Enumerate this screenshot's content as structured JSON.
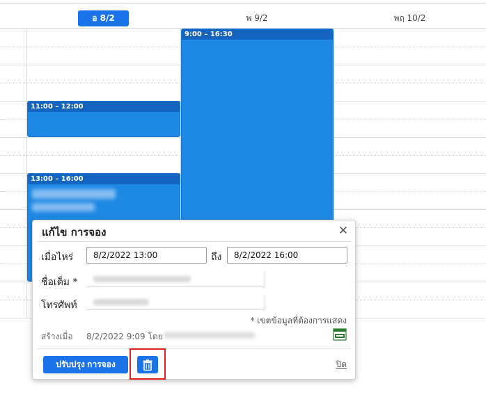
{
  "calendar": {
    "days": [
      {
        "label": "อ 8/2",
        "today": true
      },
      {
        "label": "พ 9/2",
        "today": false
      },
      {
        "label": "พฤ 10/2",
        "today": false
      }
    ],
    "events": [
      {
        "time": "9:00 – 16:30"
      },
      {
        "time": "11:00 – 12:00"
      },
      {
        "time": "13:00 – 16:00"
      }
    ]
  },
  "dialog": {
    "title": "แก้ไข การจอง",
    "close_symbol": "✕",
    "when_label": "เมื่อไหร่",
    "start_value": "8/2/2022  13:00",
    "to_label": "ถึง",
    "end_value": "8/2/2022  16:00",
    "fullname_label": "ชื่อเต็ม *",
    "phone_label": "โทรศัพท์",
    "required_note": "* เขตข้อมูลที่ต้องการแสดง",
    "created_label": "สร้างเมื่อ",
    "created_value": "8/2/2022 9:09 โดย",
    "update_button": "ปรับปรุง การจอง",
    "close_link": "ปิด",
    "icons": {
      "delete": "trash-icon",
      "ical": "ical-icon"
    }
  },
  "colors": {
    "accent": "#1a73e8",
    "event": "#1e88e5",
    "highlight": "#e0201a"
  }
}
